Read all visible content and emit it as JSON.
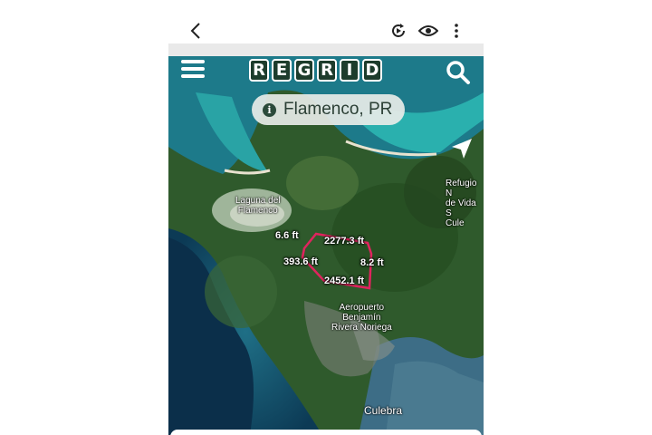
{
  "browser": {
    "back_icon": "chevron-left-icon",
    "actions": [
      "replay-icon",
      "eye-icon",
      "more-vertical-icon"
    ]
  },
  "app": {
    "logo_letters": [
      "R",
      "E",
      "G",
      "R",
      "I",
      "D"
    ],
    "menu_icon": "hamburger-menu-icon",
    "search_icon": "search-icon",
    "nav_icon": "navigation-arrow-icon"
  },
  "location": {
    "label": "Flamenco, PR",
    "icon": "info-icon"
  },
  "map": {
    "labels": {
      "laguna": "Laguna del\nFlamenco",
      "refugio": "Refugio N\nde Vida S\nCule",
      "airport": "Aeropuerto\nBenjamín\nRivera Noriega",
      "culebra": "Culebra"
    },
    "measurements": {
      "m1": "6.6 ft",
      "m2": "2277.3 ft",
      "m3": "393.6 ft",
      "m4": "8.2 ft",
      "m5": "2452.1 ft"
    },
    "parcel_color": "#e0245e"
  }
}
